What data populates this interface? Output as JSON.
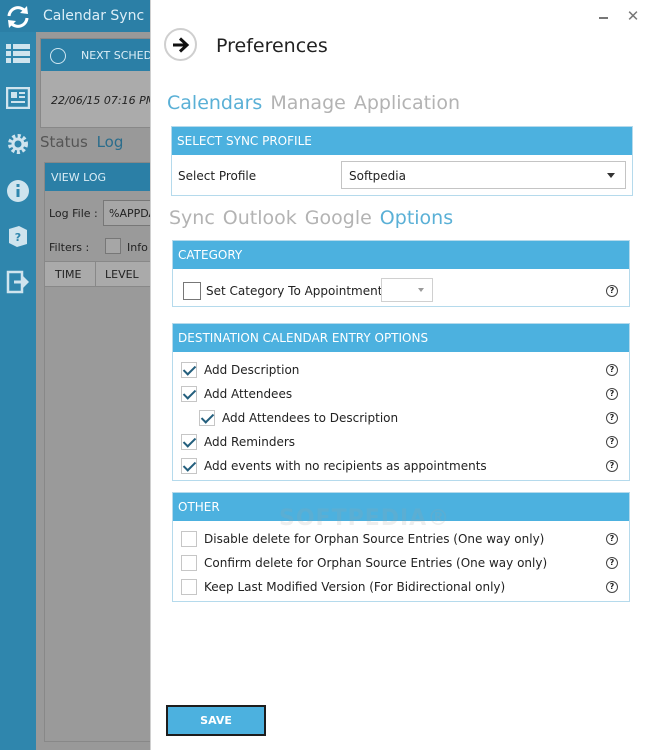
{
  "app": {
    "title": "Calendar Sync +",
    "schedule_header": "NEXT SCHEDULED",
    "schedule_date": "22/06/15 07:16 PM",
    "tabs": {
      "status": "Status",
      "log": "Log"
    },
    "log_panel": {
      "header": "VIEW LOG",
      "file_label": "Log File :",
      "file_value": "%APPDATA%",
      "filters_label": "Filters :",
      "filter_info": "Info",
      "columns": [
        "TIME",
        "LEVEL"
      ]
    },
    "sidebar_icons": [
      "list-icon",
      "document-icon",
      "gear-icon",
      "info-icon",
      "help-book-icon",
      "exit-icon"
    ]
  },
  "preferences": {
    "title": "Preferences",
    "top_tabs": [
      {
        "label": "Calendars",
        "active": true
      },
      {
        "label": "Manage",
        "active": false
      },
      {
        "label": "Application",
        "active": false
      }
    ],
    "profile": {
      "header": "SELECT SYNC PROFILE",
      "label": "Select Profile",
      "selected": "Softpedia"
    },
    "sub_tabs": [
      {
        "label": "Sync",
        "active": false
      },
      {
        "label": "Outlook",
        "active": false
      },
      {
        "label": "Google",
        "active": false
      },
      {
        "label": "Options",
        "active": true
      }
    ],
    "category": {
      "header": "CATEGORY",
      "set_category_label": "Set Category To Appointments",
      "checked": false
    },
    "destination": {
      "header": "DESTINATION CALENDAR ENTRY OPTIONS",
      "items": [
        {
          "label": "Add Description",
          "checked": true,
          "indent": false
        },
        {
          "label": "Add Attendees",
          "checked": true,
          "indent": false
        },
        {
          "label": "Add Attendees to Description",
          "checked": true,
          "indent": true
        },
        {
          "label": "Add Reminders",
          "checked": true,
          "indent": false
        },
        {
          "label": "Add events with no recipients as appointments",
          "checked": true,
          "indent": false
        }
      ]
    },
    "other": {
      "header": "OTHER",
      "items": [
        {
          "label": "Disable delete for Orphan Source Entries (One way only)",
          "checked": false
        },
        {
          "label": "Confirm delete for Orphan Source Entries (One way only)",
          "checked": false
        },
        {
          "label": "Keep Last Modified Version (For Bidirectional only)",
          "checked": false
        }
      ]
    },
    "help_glyph": "?",
    "close_glyph": "✕",
    "save_label": "SAVE",
    "watermark": "SOFTPEDIA®"
  },
  "colors": {
    "accent": "#4cb1df",
    "tab_active": "#5ab0d6",
    "tab_inactive": "#b3b3b3",
    "titlebar": "#2b7fa6"
  }
}
